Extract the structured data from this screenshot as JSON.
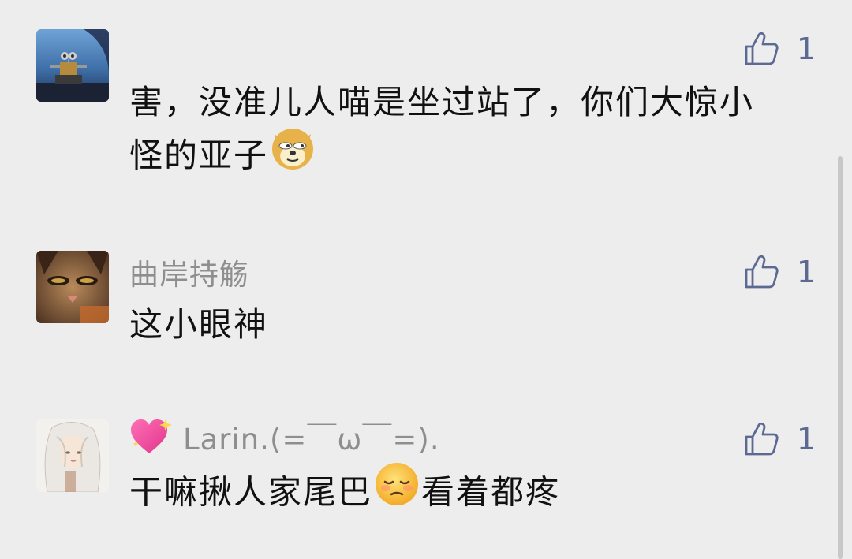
{
  "comments": [
    {
      "author": "",
      "text_line1": "害，没准儿人喵是坐过站了，你们大惊小",
      "text_line2": "怪的亚子",
      "inline_emoji": "doge-emoji",
      "avatar": "walle-robot-avatar",
      "like_count": "1"
    },
    {
      "author": "曲岸持觞",
      "text": "这小眼神",
      "avatar": "cat-face-avatar",
      "like_count": "1"
    },
    {
      "author": "Larin.(=￣ω￣=).",
      "author_badge": "sparkling-heart-icon",
      "text_before": "干嘛揪人家尾巴",
      "inline_emoji": "pensive-face-emoji",
      "text_after": "看着都疼",
      "avatar": "white-hair-anime-avatar",
      "like_count": "1"
    }
  ],
  "colors": {
    "background": "#ededed",
    "author_name": "#8e8e8e",
    "comment_text": "#111111",
    "like_accent": "#5c6a93"
  }
}
